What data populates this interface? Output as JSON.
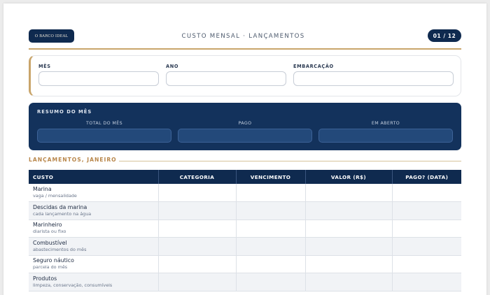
{
  "header": {
    "logo_text": "O BARCO IDEAL",
    "title": "CUSTO MENSAL · LANÇAMENTOS",
    "page_indicator": "01 / 12"
  },
  "fields": {
    "month_label": "MÊS",
    "year_label": "ANO",
    "vessel_label": "EMBARCAÇÃO",
    "month_value": "",
    "year_value": "",
    "vessel_value": ""
  },
  "summary": {
    "title": "RESUMO DO MÊS",
    "total_label": "TOTAL DO MÊS",
    "paid_label": "PAGO",
    "open_label": "EM ABERTO",
    "total_value": "",
    "paid_value": "",
    "open_value": ""
  },
  "section": {
    "title": "LANÇAMENTOS, JANEIRO"
  },
  "table": {
    "headers": [
      "CUSTO",
      "CATEGORIA",
      "VENCIMENTO",
      "VALOR (R$)",
      "PAGO? (DATA)"
    ],
    "rows": [
      {
        "title": "Marina",
        "subtitle": "vaga / mensalidade"
      },
      {
        "title": "Descidas da marina",
        "subtitle": "cada lançamento na água"
      },
      {
        "title": "Marinheiro",
        "subtitle": "diarista ou fixo"
      },
      {
        "title": "Combustível",
        "subtitle": "abastecimentos do mês"
      },
      {
        "title": "Seguro náutico",
        "subtitle": "parcela do mês"
      },
      {
        "title": "Produtos",
        "subtitle": "limpeza, conservação, consumíveis"
      }
    ]
  },
  "colors": {
    "navy": "#0f2a4f",
    "gold": "#c9a56b",
    "summary_bg": "#13325c"
  }
}
